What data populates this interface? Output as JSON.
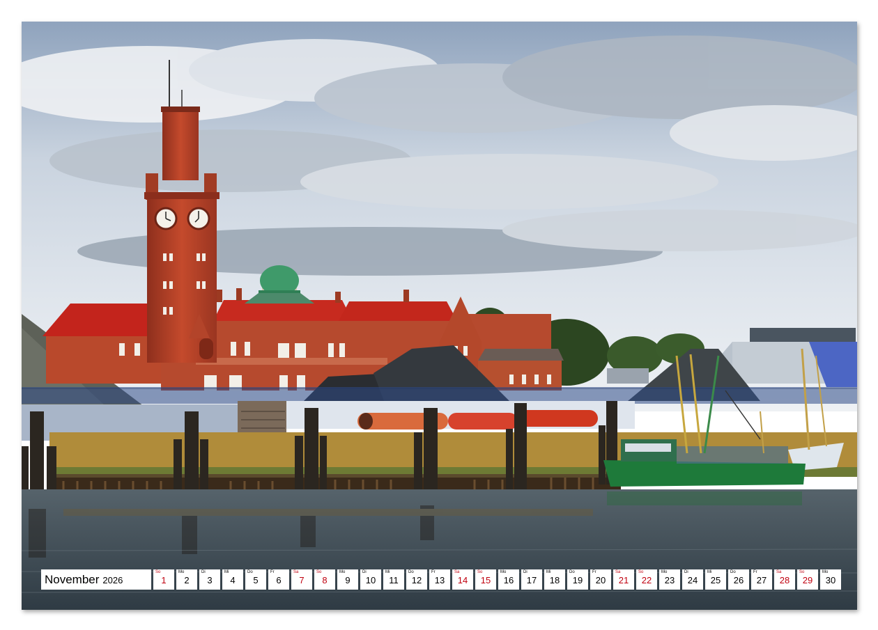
{
  "calendar": {
    "month": "November",
    "year": "2026",
    "days": [
      {
        "wd": "So",
        "n": "1",
        "we": true
      },
      {
        "wd": "Mo",
        "n": "2",
        "we": false
      },
      {
        "wd": "Di",
        "n": "3",
        "we": false
      },
      {
        "wd": "Mi",
        "n": "4",
        "we": false
      },
      {
        "wd": "Do",
        "n": "5",
        "we": false
      },
      {
        "wd": "Fr",
        "n": "6",
        "we": false
      },
      {
        "wd": "Sa",
        "n": "7",
        "we": true
      },
      {
        "wd": "So",
        "n": "8",
        "we": true
      },
      {
        "wd": "Mo",
        "n": "9",
        "we": false
      },
      {
        "wd": "Di",
        "n": "10",
        "we": false
      },
      {
        "wd": "Mi",
        "n": "11",
        "we": false
      },
      {
        "wd": "Do",
        "n": "12",
        "we": false
      },
      {
        "wd": "Fr",
        "n": "13",
        "we": false
      },
      {
        "wd": "Sa",
        "n": "14",
        "we": true
      },
      {
        "wd": "So",
        "n": "15",
        "we": true
      },
      {
        "wd": "Mo",
        "n": "16",
        "we": false
      },
      {
        "wd": "Di",
        "n": "17",
        "we": false
      },
      {
        "wd": "Mi",
        "n": "18",
        "we": false
      },
      {
        "wd": "Do",
        "n": "19",
        "we": false
      },
      {
        "wd": "Fr",
        "n": "20",
        "we": false
      },
      {
        "wd": "Sa",
        "n": "21",
        "we": true
      },
      {
        "wd": "So",
        "n": "22",
        "we": true
      },
      {
        "wd": "Mo",
        "n": "23",
        "we": false
      },
      {
        "wd": "Di",
        "n": "24",
        "we": false
      },
      {
        "wd": "Mi",
        "n": "25",
        "we": false
      },
      {
        "wd": "Do",
        "n": "26",
        "we": false
      },
      {
        "wd": "Fr",
        "n": "27",
        "we": false
      },
      {
        "wd": "Sa",
        "n": "28",
        "we": true
      },
      {
        "wd": "So",
        "n": "29",
        "we": true
      },
      {
        "wd": "Mo",
        "n": "30",
        "we": false
      }
    ]
  },
  "colors": {
    "weekend": "#c0000f",
    "brick": "#b3442a",
    "roof": "#c3241c",
    "dome": "#3f9a6a",
    "water": "#3e4a52",
    "boat_hull": "#1e7a3a"
  }
}
